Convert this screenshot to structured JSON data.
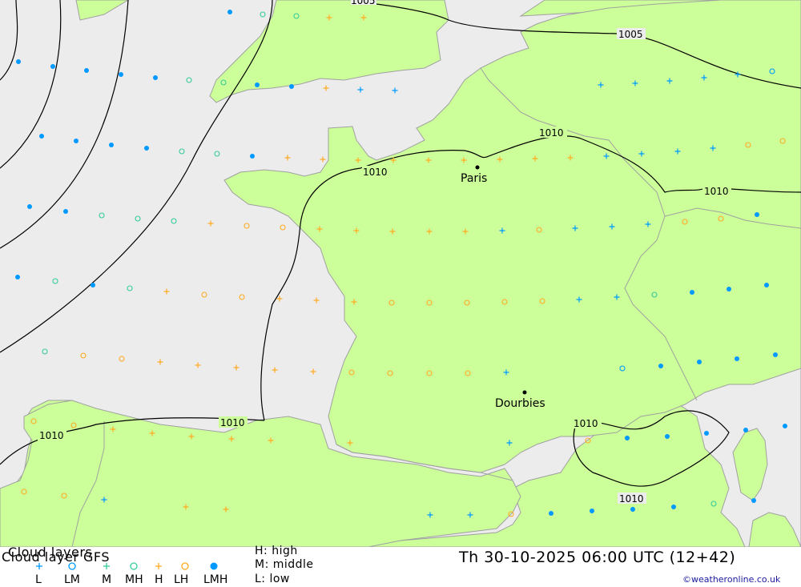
{
  "legend": {
    "title": "Cloud layers",
    "model": "Cloud layer   GFS",
    "codes": [
      "L",
      "LM",
      "M",
      "MH",
      "H",
      "LH",
      "LMH"
    ],
    "levels": [
      "H: high",
      "M: middle",
      "L: low"
    ],
    "valid_time": "Th 30-10-2025 06:00 UTC (12+42)",
    "credit": "©weatheronline.co.uk"
  },
  "map": {
    "cities": [
      {
        "name": "Paris"
      },
      {
        "name": "Dourbies"
      }
    ],
    "isobar_labels": [
      "1005",
      "1005",
      "1010",
      "1010",
      "1010",
      "1010",
      "1010",
      "1010",
      "1010"
    ]
  },
  "colors": {
    "sea": "#ececec",
    "land": "#ccff99",
    "border": "#a0a0a0",
    "isobar": "#000000",
    "low_cloud": "#0099ff",
    "mid_cloud": "#33cc99",
    "high_cloud": "#ffaa22"
  },
  "symbols": {
    "L": "plus",
    "LM": "circle",
    "M": "plus",
    "MH": "circle",
    "H": "plus",
    "LH": "circle",
    "LMH": "filled-circle"
  }
}
